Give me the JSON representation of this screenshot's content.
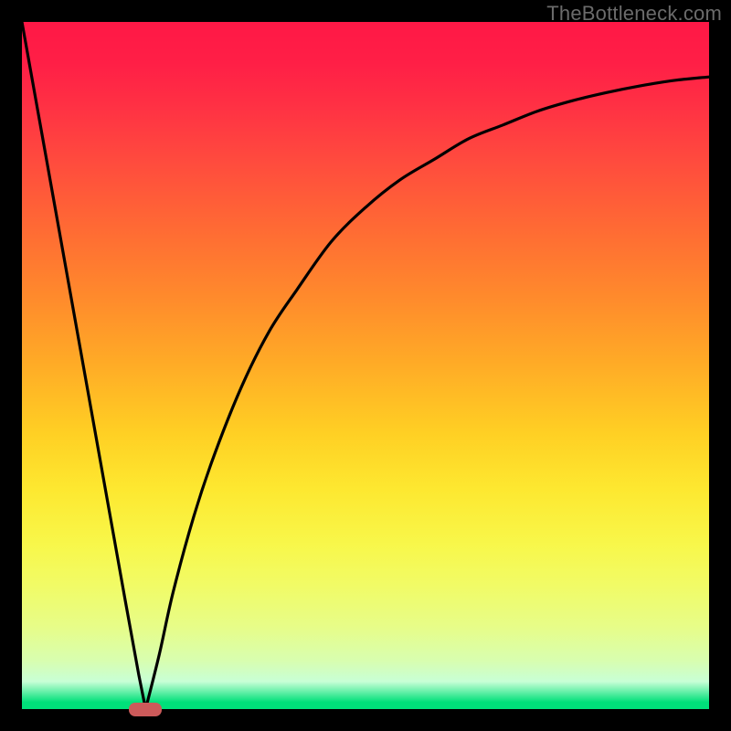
{
  "watermark": "TheBottleneck.com",
  "colors": {
    "black": "#000000",
    "curve": "#000000",
    "marker": "#cc5a5a"
  },
  "chart_data": {
    "type": "line",
    "title": "",
    "xlabel": "",
    "ylabel": "",
    "xlim": [
      0,
      100
    ],
    "ylim": [
      0,
      100
    ],
    "series": [
      {
        "name": "left-branch",
        "x": [
          0,
          5,
          10,
          15,
          17,
          18
        ],
        "values": [
          100,
          72,
          44,
          16,
          5,
          0
        ]
      },
      {
        "name": "right-branch",
        "x": [
          18,
          20,
          22,
          25,
          28,
          32,
          36,
          40,
          45,
          50,
          55,
          60,
          65,
          70,
          75,
          80,
          85,
          90,
          95,
          100
        ],
        "values": [
          0,
          8,
          17,
          28,
          37,
          47,
          55,
          61,
          68,
          73,
          77,
          80,
          83,
          85,
          87,
          88.5,
          89.7,
          90.7,
          91.5,
          92
        ]
      }
    ],
    "annotations": [
      {
        "name": "minimum-marker",
        "x": 18,
        "y": 0
      }
    ]
  }
}
